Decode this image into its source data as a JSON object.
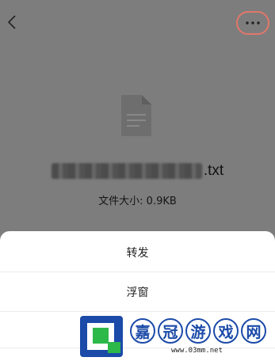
{
  "header": {
    "back_icon": "chevron-left-icon",
    "more_icon": "more-horizontal-icon"
  },
  "file": {
    "icon": "document-icon",
    "name_extension": ".txt",
    "size_text": "文件大小: 0.9KB"
  },
  "sheet": {
    "items": [
      {
        "label": "转发"
      },
      {
        "label": "浮窗"
      },
      {
        "label": ""
      }
    ]
  },
  "watermark": {
    "chars": [
      "嘉",
      "冠",
      "游",
      "戏",
      "网"
    ],
    "url": "www.03mm.net"
  },
  "colors": {
    "overlay": "#7d7d7d",
    "highlight_ring": "#e2776a",
    "watermark_blue": "#1b4aa8",
    "watermark_green": "#2db84a"
  }
}
